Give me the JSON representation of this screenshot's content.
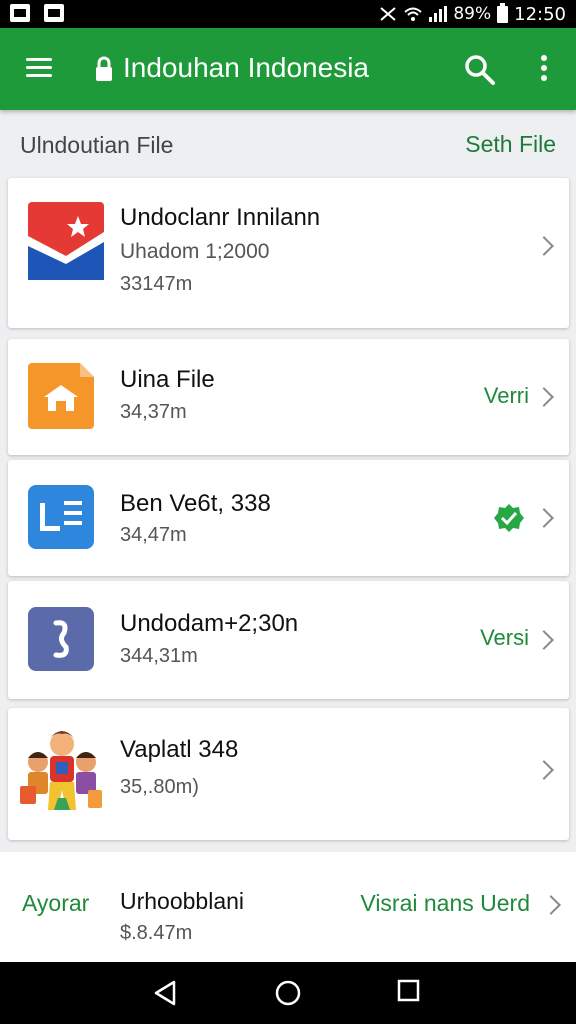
{
  "status_bar": {
    "battery": "89%",
    "time": "12:50"
  },
  "app_bar": {
    "title": "Indouhan Indonesia"
  },
  "section": {
    "title": "Ulndoutian File",
    "link": "Seth File"
  },
  "cards": [
    {
      "title": "Undoclanr Innilann",
      "subtitle": "Uhadom 1;2000",
      "meta": "33147m",
      "action": ""
    },
    {
      "title": "Uina File",
      "subtitle": "",
      "meta": "34,37m",
      "action": "Verri"
    },
    {
      "title": "Ben Ve6t, 338",
      "subtitle": "",
      "meta": "34,47m",
      "action": ""
    },
    {
      "title": "Undodam+2;30n",
      "subtitle": "",
      "meta": "344,31m",
      "action": "Versi"
    },
    {
      "title": "Vaplatl 348",
      "subtitle": "",
      "meta": "35,.80m)",
      "action": ""
    }
  ],
  "bottom": {
    "left_label": "Ayorar",
    "title": "Urhoobblani",
    "meta": "$.8.47m",
    "action": "Visrai nans Uerd"
  },
  "colors": {
    "app_bar": "#1e9a3a",
    "accent_text": "#1f8a3a"
  }
}
